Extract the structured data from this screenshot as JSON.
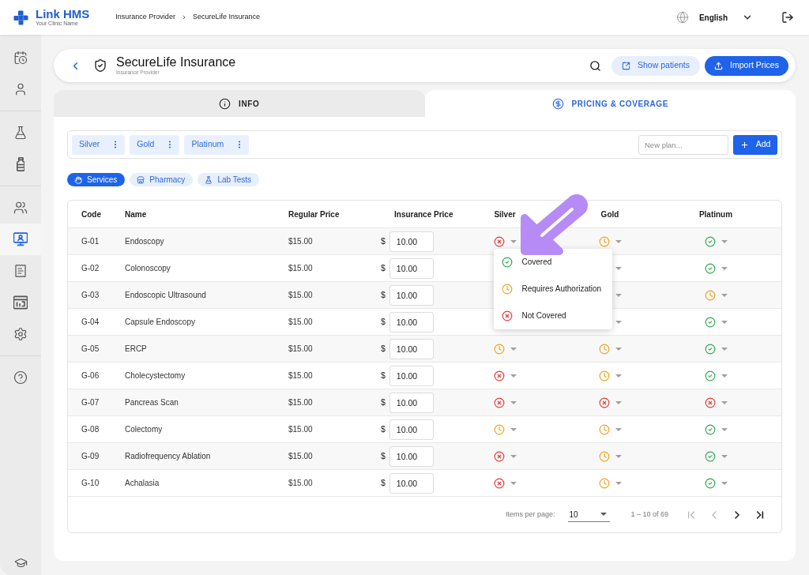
{
  "app": {
    "name": "Link HMS",
    "tagline": "Your Clinic Name"
  },
  "breadcrumb": [
    "Insurance Provider",
    "SecureLife Insurance"
  ],
  "language": "English",
  "sidebar": {
    "groups": [
      {
        "items": [
          {
            "selected": false
          },
          {
            "selected": false
          }
        ]
      },
      {
        "items": [
          {
            "selected": false
          },
          {
            "selected": false
          }
        ]
      },
      {
        "items": [
          {
            "selected": false
          },
          {
            "selected": true
          },
          {
            "selected": false
          },
          {
            "selected": false
          },
          {
            "selected": false
          }
        ]
      },
      {
        "items": [
          {
            "selected": false
          }
        ]
      }
    ],
    "footer_items": [
      {
        "selected": false
      }
    ]
  },
  "page_header": {
    "title": "SecureLife Insurance",
    "subtitle": "Insurance Provider",
    "buttons": [
      {
        "label": "Show patients",
        "kind": "secondary"
      },
      {
        "label": "Import Prices",
        "kind": "primary"
      }
    ]
  },
  "tabs": [
    {
      "label": "INFO",
      "selected": false
    },
    {
      "label": "PRICING & COVERAGE",
      "selected": true
    }
  ],
  "plans": [
    "Silver",
    "Gold",
    "Platinum"
  ],
  "new_plan": {
    "placeholder": "New plan...",
    "button": "Add"
  },
  "categories": [
    {
      "label": "Services",
      "selected": true
    },
    {
      "label": "Pharmacy",
      "selected": false
    },
    {
      "label": "Lab Tests",
      "selected": false
    }
  ],
  "table": {
    "columns": [
      "Code",
      "Name",
      "Regular Price",
      "Insurance Price",
      "Silver",
      "Gold",
      "Platinum"
    ],
    "rows": [
      {
        "code": "G-01",
        "name": "Endoscopy",
        "regular_price": "$15.00",
        "currency": "$",
        "insurance_price": "10.00",
        "coverage": [
          {
            "kind": "cross",
            "menu": [
              {
                "label": "Covered",
                "kind": "check"
              },
              {
                "label": "Requires Authorization",
                "kind": "clock"
              },
              {
                "label": "Not Covered",
                "kind": "cross"
              }
            ]
          },
          {
            "kind": "clock"
          },
          {
            "kind": "check"
          }
        ]
      },
      {
        "code": "G-02",
        "name": "Colonoscopy",
        "regular_price": "$15.00",
        "currency": "$",
        "insurance_price": "10.00",
        "coverage": [
          {
            "kind": "hidden"
          },
          {
            "kind": "caret"
          },
          {
            "kind": "check"
          }
        ]
      },
      {
        "code": "G-03",
        "name": "Endoscopic Ultrasound",
        "regular_price": "$15.00",
        "currency": "$",
        "insurance_price": "10.00",
        "coverage": [
          {
            "kind": "hidden"
          },
          {
            "kind": "caret"
          },
          {
            "kind": "clock"
          }
        ]
      },
      {
        "code": "G-04",
        "name": "Capsule Endoscopy",
        "regular_price": "$15.00",
        "currency": "$",
        "insurance_price": "10.00",
        "coverage": [
          {
            "kind": "hidden"
          },
          {
            "kind": "caret"
          },
          {
            "kind": "check"
          }
        ]
      },
      {
        "code": "G-05",
        "name": "ERCP",
        "regular_price": "$15.00",
        "currency": "$",
        "insurance_price": "10.00",
        "coverage": [
          {
            "kind": "clock"
          },
          {
            "kind": "clock"
          },
          {
            "kind": "check"
          }
        ]
      },
      {
        "code": "G-06",
        "name": "Cholecystectomy",
        "regular_price": "$15.00",
        "currency": "$",
        "insurance_price": "10.00",
        "coverage": [
          {
            "kind": "cross"
          },
          {
            "kind": "clock"
          },
          {
            "kind": "check"
          }
        ]
      },
      {
        "code": "G-07",
        "name": "Pancreas Scan",
        "regular_price": "$15.00",
        "currency": "$",
        "insurance_price": "10.00",
        "coverage": [
          {
            "kind": "cross"
          },
          {
            "kind": "cross"
          },
          {
            "kind": "cross"
          }
        ]
      },
      {
        "code": "G-08",
        "name": "Colectomy",
        "regular_price": "$15.00",
        "currency": "$",
        "insurance_price": "10.00",
        "coverage": [
          {
            "kind": "clock"
          },
          {
            "kind": "clock"
          },
          {
            "kind": "check"
          }
        ]
      },
      {
        "code": "G-09",
        "name": "Radiofrequency Ablation",
        "regular_price": "$15.00",
        "currency": "$",
        "insurance_price": "10.00",
        "coverage": [
          {
            "kind": "cross"
          },
          {
            "kind": "clock"
          },
          {
            "kind": "check"
          }
        ]
      },
      {
        "code": "G-10",
        "name": "Achalasia",
        "regular_price": "$15.00",
        "currency": "$",
        "insurance_price": "10.00",
        "coverage": [
          {
            "kind": "cross"
          },
          {
            "kind": "clock"
          },
          {
            "kind": "check"
          }
        ]
      }
    ]
  },
  "pagination": {
    "items_per_page_label": "Items per page:",
    "page_size": "10",
    "range": "1 – 10 of 69",
    "buttons": [
      {
        "kind": "first",
        "disabled": true
      },
      {
        "kind": "previous",
        "disabled": true
      },
      {
        "kind": "next",
        "disabled": false
      },
      {
        "kind": "last",
        "disabled": false
      }
    ]
  }
}
